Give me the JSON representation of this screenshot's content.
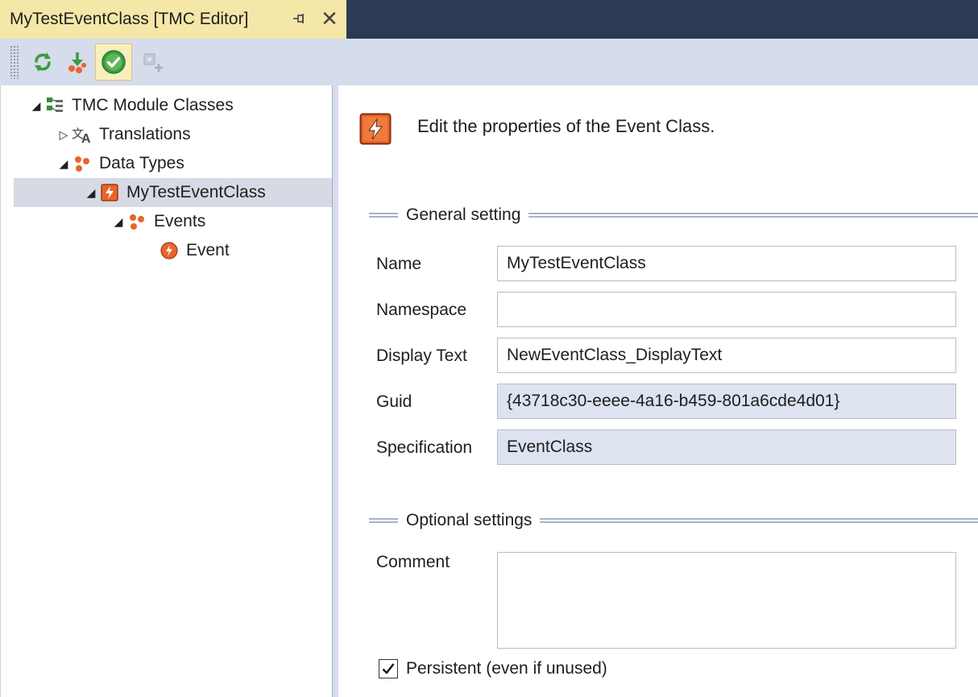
{
  "tab": {
    "title": "MyTestEventClass [TMC Editor]",
    "pin_glyph": "⊣",
    "close_glyph": "✕"
  },
  "toolbar": {
    "buttons": [
      {
        "name": "refresh-icon",
        "active": false
      },
      {
        "name": "download-icon",
        "active": false
      },
      {
        "name": "check-icon",
        "active": true
      },
      {
        "name": "add-module-icon",
        "active": false
      }
    ]
  },
  "tree": {
    "items": [
      {
        "label": "TMC Module Classes",
        "icon": "module-classes-icon",
        "expander": "expanded"
      },
      {
        "label": "Translations",
        "icon": "translations-icon",
        "expander": "collapsed"
      },
      {
        "label": "Data Types",
        "icon": "data-types-icon",
        "expander": "expanded"
      },
      {
        "label": "MyTestEventClass",
        "icon": "event-class-icon",
        "expander": "expanded",
        "selected": true
      },
      {
        "label": "Events",
        "icon": "events-icon",
        "expander": "expanded"
      },
      {
        "label": "Event",
        "icon": "event-icon",
        "expander": "none"
      }
    ]
  },
  "content": {
    "header_text": "Edit the properties of the Event Class.",
    "general": {
      "title": "General setting",
      "name_label": "Name",
      "name_value": "MyTestEventClass",
      "namespace_label": "Namespace",
      "namespace_value": "",
      "display_label": "Display Text",
      "display_value": "NewEventClass_DisplayText",
      "guid_label": "Guid",
      "guid_value": "{43718c30-eeee-4a16-b459-801a6cde4d01}",
      "spec_label": "Specification",
      "spec_value": "EventClass"
    },
    "optional": {
      "title": "Optional settings",
      "comment_label": "Comment",
      "comment_value": "",
      "persistent_label": "Persistent (even if unused)",
      "persistent_checked": true
    }
  },
  "colors": {
    "accent_orange": "#e8652a",
    "tab_bg": "#f5e7a8",
    "titlebar_bg": "#2b3a55",
    "toolbar_bg": "#d5dcec",
    "readonly_bg": "#dde3ef"
  }
}
